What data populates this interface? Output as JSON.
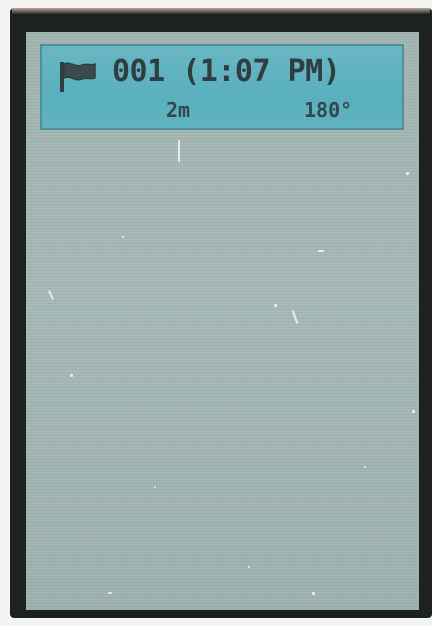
{
  "waypoint": {
    "title": "001 (1:07 PM)",
    "distance": "2m",
    "bearing": "180°",
    "icon": "flag-icon"
  },
  "colors": {
    "header_bg": "#5ab0bf",
    "screen_bg": "#a3b5b2",
    "text": "#2f3e41"
  }
}
